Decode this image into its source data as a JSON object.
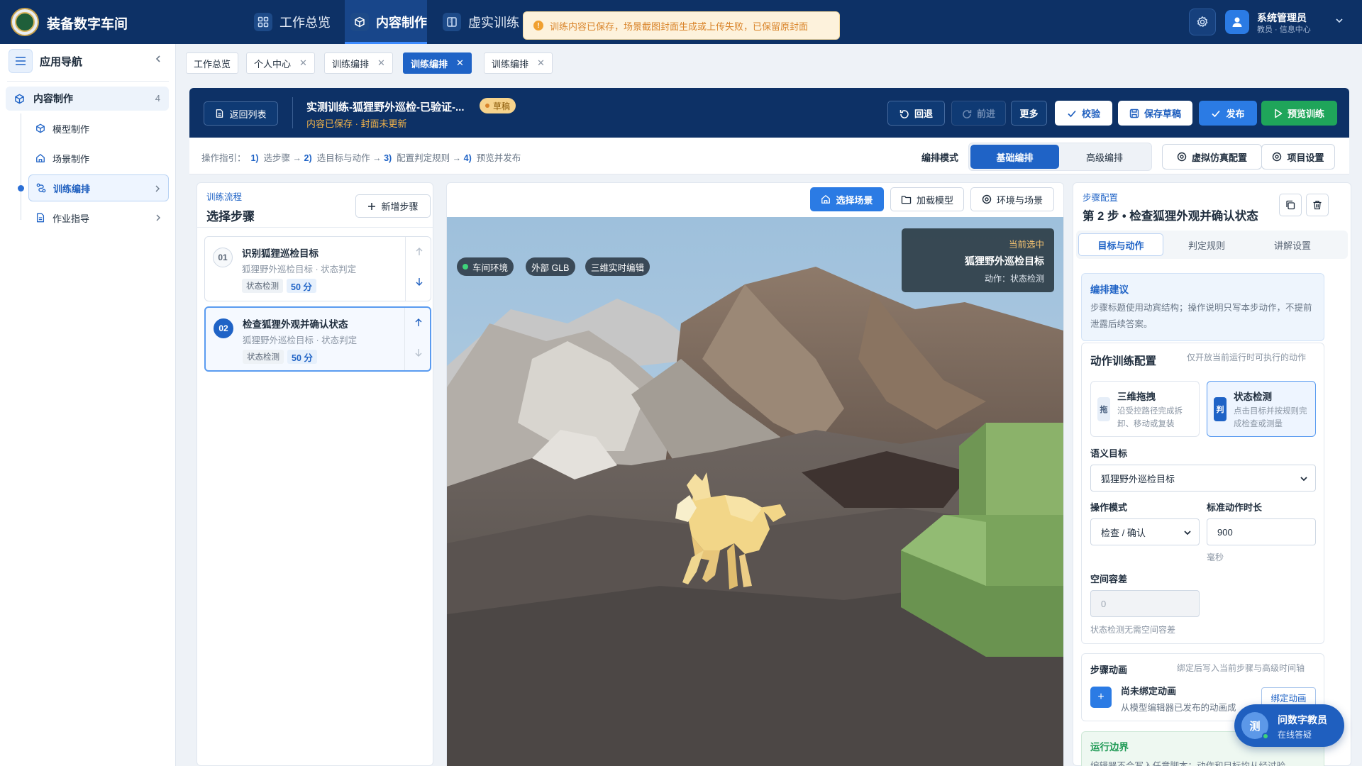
{
  "app": {
    "title": "装备数字车间"
  },
  "nav": [
    {
      "label": "工作总览",
      "icon": "grid-icon"
    },
    {
      "label": "内容制作",
      "icon": "cube-icon",
      "active": true
    },
    {
      "label": "虚实训练",
      "icon": "book-icon"
    }
  ],
  "toast": {
    "text": "训练内容已保存，场景截图封面生成或上传失败，已保留原封面",
    "icon": "warning-icon"
  },
  "user": {
    "name": "系统管理员",
    "role": "教员 · 信息中心"
  },
  "sidebar": {
    "title": "应用导航",
    "group": {
      "label": "内容制作",
      "count": "4"
    },
    "items": [
      {
        "label": "模型制作",
        "icon": "cube-icon"
      },
      {
        "label": "场景制作",
        "icon": "home-icon"
      },
      {
        "label": "训练编排",
        "icon": "flow-icon",
        "active": true
      },
      {
        "label": "作业指导",
        "icon": "doc-icon"
      }
    ]
  },
  "tabs": [
    {
      "label": "工作总览",
      "closable": false
    },
    {
      "label": "个人中心",
      "closable": true
    },
    {
      "label": "训练编排",
      "closable": true
    },
    {
      "label": "训练编排",
      "closable": true,
      "active": true
    },
    {
      "label": "训练编排",
      "closable": true
    }
  ],
  "editor": {
    "back_label": "返回列表",
    "title": "实测训练-狐狸野外巡检-已验证-...",
    "status_badge": "草稿",
    "subtitle": "内容已保存 · 封面未更新",
    "undo_label": "回退",
    "redo_label": "前进",
    "more_label": "更多",
    "validate_label": "校验",
    "save_label": "保存草稿",
    "publish_label": "发布",
    "preview_label": "预览训练"
  },
  "guide": {
    "prefix": "操作指引：",
    "steps": [
      {
        "n": "1)",
        "t": "选步骤"
      },
      {
        "n": "2)",
        "t": "选目标与动作"
      },
      {
        "n": "3)",
        "t": "配置判定规则"
      },
      {
        "n": "4)",
        "t": "预览并发布"
      }
    ],
    "arrow": "→"
  },
  "mode": {
    "label": "编排模式",
    "basic": "基础编排",
    "advanced": "高级编排"
  },
  "sim_config_label": "虚拟仿真配置",
  "project_settings_label": "项目设置",
  "flow": {
    "kicker": "训练流程",
    "title": "选择步骤",
    "add_label": "新增步骤",
    "steps": [
      {
        "num": "01",
        "title": "识别狐狸巡检目标",
        "subtitle": "狐狸野外巡检目标 · 状态判定",
        "tag": "状态检测",
        "score": "50 分"
      },
      {
        "num": "02",
        "title": "检查狐狸外观并确认状态",
        "subtitle": "狐狸野外巡检目标 · 状态判定",
        "tag": "状态检测",
        "score": "50 分",
        "active": true
      }
    ]
  },
  "viewport": {
    "buttons": [
      {
        "label": "选择场景",
        "icon": "home-icon",
        "active": true
      },
      {
        "label": "加载模型",
        "icon": "folder-icon"
      },
      {
        "label": "环境与场景",
        "icon": "settings-icon"
      }
    ],
    "chips": [
      "车间环境",
      "外部 GLB",
      "三维实时编辑"
    ],
    "selection": {
      "kicker": "当前选中",
      "name": "狐狸野外巡检目标",
      "action": "动作：状态检测"
    }
  },
  "config": {
    "kicker": "步骤配置",
    "title": "第 2 步 • 检查狐狸外观并确认状态",
    "tabs": [
      "目标与动作",
      "判定规则",
      "讲解设置"
    ],
    "tip": {
      "title": "编排建议",
      "body": "步骤标题使用动宾结构；操作说明只写本步动作，不提前泄露后续答案。"
    },
    "action": {
      "title": "动作训练配置",
      "hint": "仅开放当前运行时可执行的动作",
      "options": [
        {
          "badge": "拖",
          "title": "三维拖拽",
          "desc": "沿受控路径完成拆卸、移动或复装"
        },
        {
          "badge": "判",
          "title": "状态检测",
          "desc": "点击目标并按规则完成检查或测量",
          "active": true
        }
      ],
      "target_label": "语义目标",
      "target_value": "狐狸野外巡检目标",
      "op_label": "操作模式",
      "op_value": "检查 / 确认",
      "duration_label": "标准动作时长",
      "duration_value": "900",
      "duration_unit": "毫秒",
      "tolerance_label": "空间容差",
      "tolerance_value": "0",
      "tolerance_note": "状态检测无需空间容差"
    },
    "animation": {
      "title": "步骤动画",
      "hint": "绑定后写入当前步骤与高级时间轴",
      "none_label": "尚未绑定动画",
      "desc": "从模型编辑器已发布的动画成",
      "bind_label": "绑定动画"
    },
    "boundary": {
      "title": "运行边界",
      "body": "编辑器不会写入任意脚本；动作和目标均从经过验"
    }
  },
  "assistant": {
    "avatar": "测",
    "name": "问数字教员",
    "status": "在线答疑"
  },
  "colors": {
    "primary": "#1f63c6",
    "header": "#0d3166",
    "success": "#1fa55a",
    "warning": "#f0a030"
  }
}
